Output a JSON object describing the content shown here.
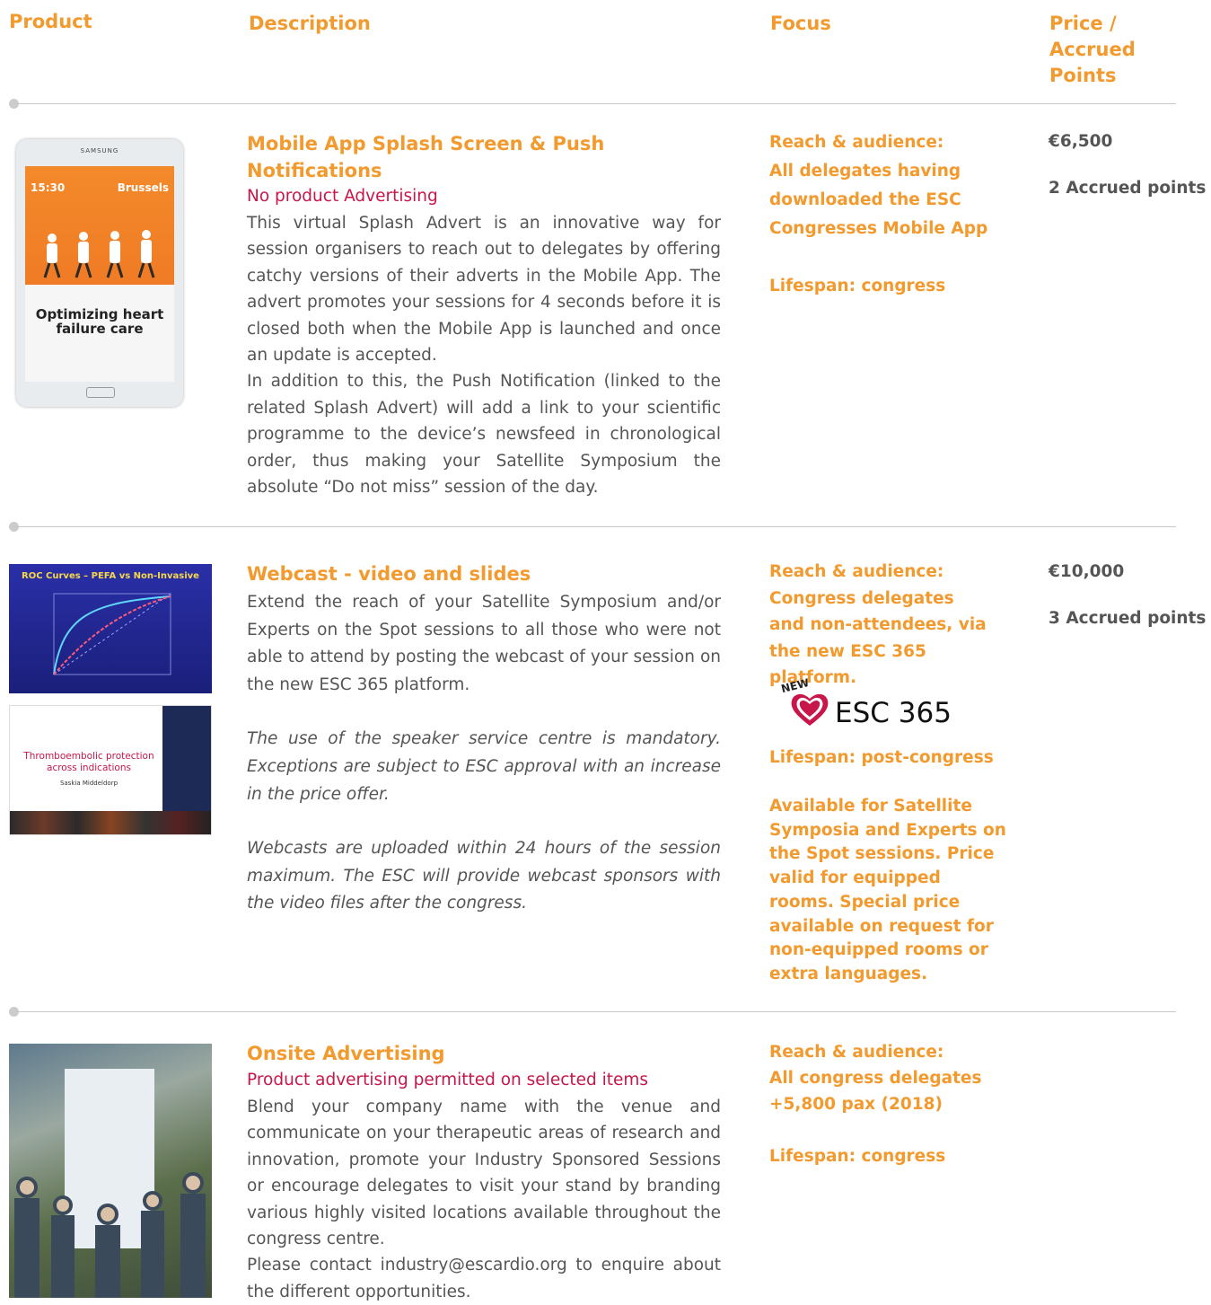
{
  "headers": {
    "product": "Product",
    "description": "Description",
    "focus": "Focus",
    "price": [
      "Price /",
      "Accrued",
      "Points"
    ]
  },
  "rows": [
    {
      "image": {
        "brand": "SAMSUNG",
        "time": "15:30",
        "city": "Brussels",
        "caption": "Optimizing heart failure care"
      },
      "title": "Mobile App Splash Screen & Push Notifications",
      "subtitle": "No product Advertising",
      "description": [
        "This virtual Splash Advert is an innovative way for session organisers to reach out to delegates by offering catchy versions of their adverts in the Mobile App. The advert promotes your sessions for 4 seconds before it is closed both when the Mobile App is launched and once an update is accepted.",
        "In addition to this, the Push Notification (linked to the related Splash Advert) will add a link to your scientific programme to the device’s newsfeed in chronological order, thus making your Satellite Symposium the absolute “Do not miss” session of the day."
      ],
      "focus_reach_label": "Reach & audience:",
      "focus_reach": "All delegates having downloaded the ESC Congresses Mobile App",
      "focus_lifespan": "Lifespan: congress",
      "price": "€6,500",
      "points": "2 Accrued points"
    },
    {
      "image": {
        "slide1_title": "ROC Curves – PEFA vs Non-Invasive",
        "slide2_title": "Thromboembolic protection across indications",
        "slide2_name": "Saskia Middeldorp"
      },
      "title": "Webcast - video and slides",
      "description": [
        "Extend the reach of your Satellite Symposium and/or Experts on the Spot sessions to all those who were not able to attend by posting the webcast of your session on the new ESC 365 platform.",
        "The use of the speaker service centre is mandatory. Exceptions are subject to ESC approval with an increase in the price offer.",
        "Webcasts are uploaded within 24 hours of the session maximum. The ESC will provide webcast sponsors with the video files after the congress."
      ],
      "focus_reach_label": "Reach & audience:",
      "focus_reach": "Congress delegates and non-attendees, via the new ESC 365 platform.",
      "logo_new": "NEW",
      "logo_text": "ESC 365",
      "focus_lifespan": "Lifespan: post-congress",
      "focus_notes": "Available for Satellite Symposia and Experts on the Spot sessions. Price valid for equipped rooms. Special price available on request for non-equipped rooms or extra languages.",
      "price": "€10,000",
      "points": "3 Accrued points"
    },
    {
      "title": "Onsite Advertising",
      "subtitle": "Product advertising permitted on selected items",
      "description": [
        "Blend your company name with the venue and communicate on your therapeutic areas of research and innovation, promote your Industry Sponsored Sessions or encourage delegates to visit your stand by branding various highly visited locations available throughout the congress centre.",
        "Please contact industry@escardio.org to enquire about the different opportunities."
      ],
      "focus_reach_label": "Reach & audience:",
      "focus_reach": "All congress delegates +5,800 pax (2018)",
      "focus_lifespan": "Lifespan: congress"
    }
  ],
  "colors": {
    "accent": "#f29a2e",
    "subtitle": "#c8164a",
    "body": "#555555"
  }
}
